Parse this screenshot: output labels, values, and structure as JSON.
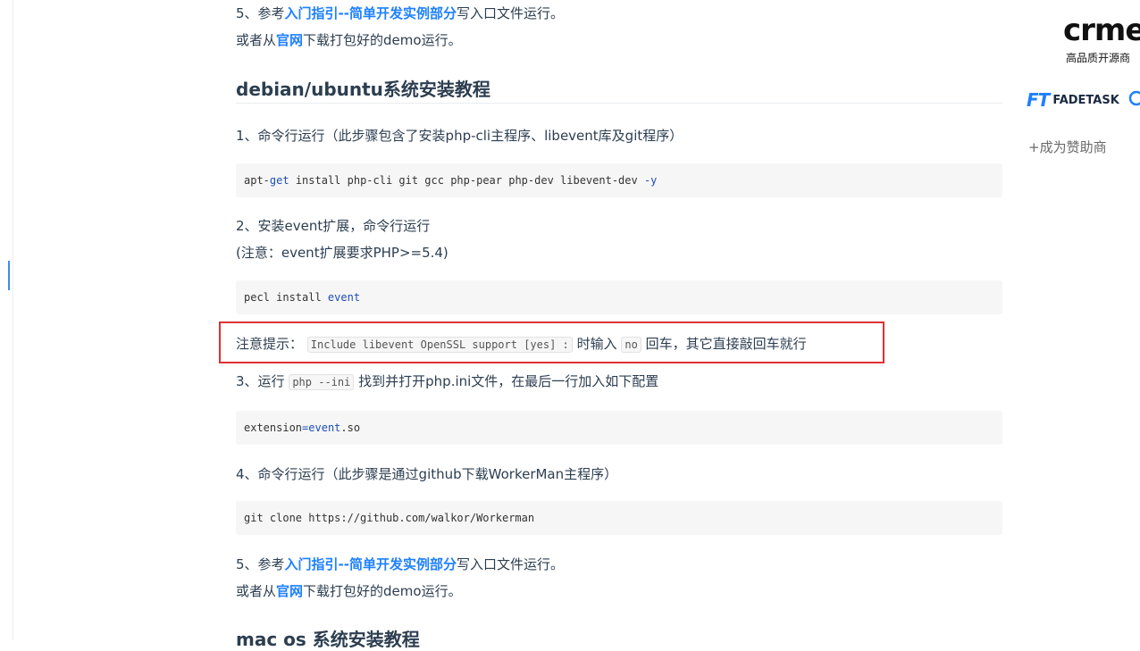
{
  "section_top": {
    "step5_prefix": "5、参考",
    "step5_link": "入门指引--简单开发实例部分",
    "step5_suffix": "写入口文件运行。",
    "download_prefix": "或者从",
    "download_link": "官网",
    "download_suffix": "下载打包好的demo运行。"
  },
  "debian": {
    "heading": "debian/ubuntu系统安装教程",
    "step1": "1、命令行运行（此步骤包含了安装php-cli主程序、libevent库及git程序）",
    "step1_code": {
      "a": "apt-",
      "b": "get",
      "c": " install php-cli git gcc php-pear php-dev libevent-dev ",
      "d": "-y"
    },
    "step2": "2、安装event扩展，命令行运行",
    "step2_note": "(注意：event扩展要求PHP>=5.4)",
    "step2_code": {
      "a": "pecl install ",
      "b": "event"
    },
    "tip_label": "注意提示：",
    "tip_code": "Include libevent OpenSSL support [yes] :",
    "tip_mid": "时输入",
    "tip_no": "no",
    "tip_end": "回车，其它直接敲回车就行",
    "step3_prefix": "3、运行",
    "step3_code": "php --ini",
    "step3_suffix": "找到并打开php.ini文件，在最后一行加入如下配置",
    "step3_block": {
      "a": "extension",
      "b": "=",
      "c": "event",
      "d": ".so"
    },
    "step4": "4、命令行运行（此步骤是通过github下载WorkerMan主程序）",
    "step4_code": "git clone https://github.com/walkor/Workerman",
    "step5_prefix": "5、参考",
    "step5_link": "入门指引--简单开发实例部分",
    "step5_suffix": "写入口文件运行。",
    "download_prefix": "或者从",
    "download_link": "官网",
    "download_suffix": "下载打包好的demo运行。"
  },
  "mac": {
    "heading": "mac os 系统安装教程"
  },
  "sponsors": {
    "crmeb_logo": "crme",
    "crmeb_sub": "高品质开源商",
    "fadetask_mark": "FT",
    "fadetask_name": "FADETASK",
    "become_sponsor": "+成为赞助商"
  },
  "colors": {
    "link": "#1e80ff",
    "text": "#2c3e50",
    "highlight_border": "#e03131",
    "code_bg": "#f6f6f6"
  }
}
